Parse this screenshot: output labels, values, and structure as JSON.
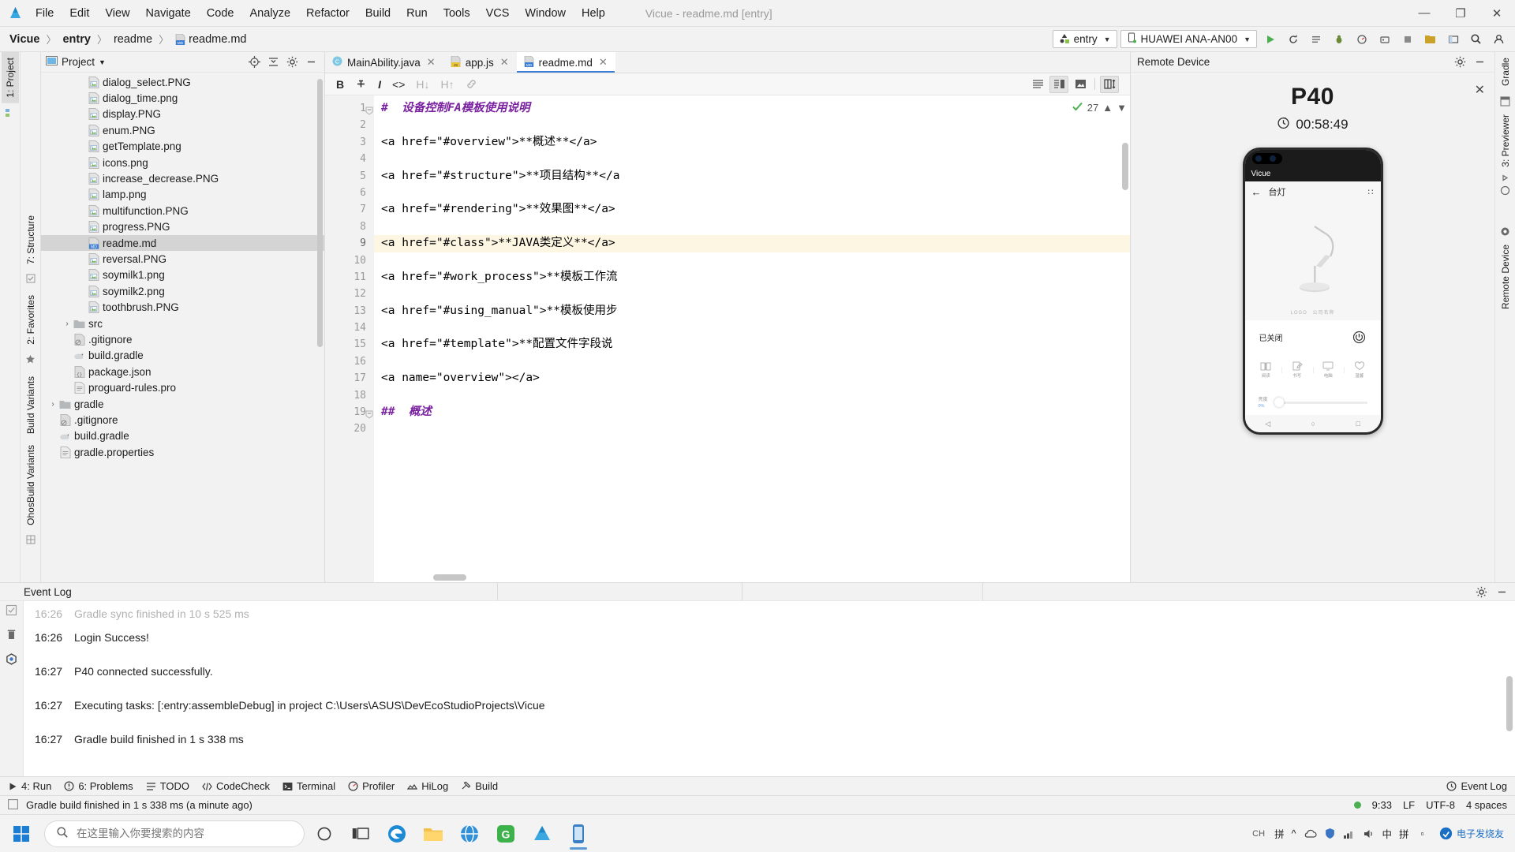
{
  "window": {
    "title": "Vicue - readme.md [entry]",
    "minimize": "—",
    "maximize": "❐",
    "close": "✕"
  },
  "menu": [
    "File",
    "Edit",
    "View",
    "Navigate",
    "Code",
    "Analyze",
    "Refactor",
    "Build",
    "Run",
    "Tools",
    "VCS",
    "Window",
    "Help"
  ],
  "breadcrumb": {
    "items": [
      "Vicue",
      "entry",
      "readme",
      "readme.md"
    ],
    "separator": "〉"
  },
  "toolbar": {
    "module_selector": "entry",
    "device_selector": "HUAWEI ANA-AN00",
    "caret": "▼"
  },
  "project_pane": {
    "title": "Project",
    "caret": "▼",
    "tree": [
      {
        "label": "dialog_select.PNG",
        "icon": "image-file-icon",
        "indent": 3,
        "arrow": "",
        "selected": false
      },
      {
        "label": "dialog_time.png",
        "icon": "image-file-icon",
        "indent": 3,
        "arrow": "",
        "selected": false
      },
      {
        "label": "display.PNG",
        "icon": "image-file-icon",
        "indent": 3,
        "arrow": "",
        "selected": false
      },
      {
        "label": "enum.PNG",
        "icon": "image-file-icon",
        "indent": 3,
        "arrow": "",
        "selected": false
      },
      {
        "label": "getTemplate.png",
        "icon": "image-file-icon",
        "indent": 3,
        "arrow": "",
        "selected": false
      },
      {
        "label": "icons.png",
        "icon": "image-file-icon",
        "indent": 3,
        "arrow": "",
        "selected": false
      },
      {
        "label": "increase_decrease.PNG",
        "icon": "image-file-icon",
        "indent": 3,
        "arrow": "",
        "selected": false
      },
      {
        "label": "lamp.png",
        "icon": "image-file-icon",
        "indent": 3,
        "arrow": "",
        "selected": false
      },
      {
        "label": "multifunction.PNG",
        "icon": "image-file-icon",
        "indent": 3,
        "arrow": "",
        "selected": false
      },
      {
        "label": "progress.PNG",
        "icon": "image-file-icon",
        "indent": 3,
        "arrow": "",
        "selected": false
      },
      {
        "label": "readme.md",
        "icon": "markdown-file-icon",
        "indent": 3,
        "arrow": "",
        "selected": true
      },
      {
        "label": "reversal.PNG",
        "icon": "image-file-icon",
        "indent": 3,
        "arrow": "",
        "selected": false
      },
      {
        "label": "soymilk1.png",
        "icon": "image-file-icon",
        "indent": 3,
        "arrow": "",
        "selected": false
      },
      {
        "label": "soymilk2.png",
        "icon": "image-file-icon",
        "indent": 3,
        "arrow": "",
        "selected": false
      },
      {
        "label": "toothbrush.PNG",
        "icon": "image-file-icon",
        "indent": 3,
        "arrow": "",
        "selected": false
      },
      {
        "label": "src",
        "icon": "folder-icon",
        "indent": 2,
        "arrow": "›",
        "selected": false
      },
      {
        "label": ".gitignore",
        "icon": "gitignore-file-icon",
        "indent": 2,
        "arrow": "",
        "selected": false
      },
      {
        "label": "build.gradle",
        "icon": "gradle-file-icon",
        "indent": 2,
        "arrow": "",
        "selected": false
      },
      {
        "label": "package.json",
        "icon": "json-file-icon",
        "indent": 2,
        "arrow": "",
        "selected": false
      },
      {
        "label": "proguard-rules.pro",
        "icon": "text-file-icon",
        "indent": 2,
        "arrow": "",
        "selected": false
      },
      {
        "label": "gradle",
        "icon": "folder-icon",
        "indent": 1,
        "arrow": "›",
        "selected": false
      },
      {
        "label": ".gitignore",
        "icon": "gitignore-file-icon",
        "indent": 1,
        "arrow": "",
        "selected": false
      },
      {
        "label": "build.gradle",
        "icon": "gradle-file-icon",
        "indent": 1,
        "arrow": "",
        "selected": false
      },
      {
        "label": "gradle.properties",
        "icon": "properties-file-icon",
        "indent": 1,
        "arrow": "",
        "selected": false
      }
    ]
  },
  "left_strips": {
    "outer": [
      "1: Project"
    ],
    "inner": [
      "7: Structure",
      "2: Favorites",
      "Build Variants",
      "OhosBuild Variants"
    ]
  },
  "right_strips": [
    "Gradle",
    "3: Previewer",
    "Remote Device"
  ],
  "editor": {
    "tabs": [
      {
        "label": "MainAbility.java",
        "icon": "java-file-icon",
        "active": false,
        "close": "✕"
      },
      {
        "label": "app.js",
        "icon": "js-file-icon",
        "active": false,
        "close": "✕"
      },
      {
        "label": "readme.md",
        "icon": "markdown-file-icon",
        "active": true,
        "close": "✕"
      }
    ],
    "md_toolbar": [
      "B",
      "S",
      "I",
      "<>",
      "H↓",
      "H↑",
      "link"
    ],
    "inspection_count": "27",
    "lines": [
      {
        "n": "1",
        "text": "#  设备控制FA模板使用说明",
        "style": "h1",
        "fold": true,
        "hl": false
      },
      {
        "n": "2",
        "text": "",
        "style": "",
        "fold": false,
        "hl": false
      },
      {
        "n": "3",
        "text": "<a href=\"#overview\">**概述**</a>",
        "style": "code",
        "fold": false,
        "hl": false
      },
      {
        "n": "4",
        "text": "",
        "style": "",
        "fold": false,
        "hl": false
      },
      {
        "n": "5",
        "text": "<a href=\"#structure\">**项目结构**</a",
        "style": "code",
        "fold": false,
        "hl": false
      },
      {
        "n": "6",
        "text": "",
        "style": "",
        "fold": false,
        "hl": false
      },
      {
        "n": "7",
        "text": "<a href=\"#rendering\">**效果图**</a>",
        "style": "code",
        "fold": false,
        "hl": false
      },
      {
        "n": "8",
        "text": "",
        "style": "",
        "fold": false,
        "hl": false
      },
      {
        "n": "9",
        "text": "<a href=\"#class\">**JAVA类定义**</a>",
        "style": "code",
        "fold": false,
        "hl": true
      },
      {
        "n": "10",
        "text": "",
        "style": "",
        "fold": false,
        "hl": false
      },
      {
        "n": "11",
        "text": "<a href=\"#work_process\">**模板工作流",
        "style": "code",
        "fold": false,
        "hl": false
      },
      {
        "n": "12",
        "text": "",
        "style": "",
        "fold": false,
        "hl": false
      },
      {
        "n": "13",
        "text": "<a href=\"#using_manual\">**模板使用步",
        "style": "code",
        "fold": false,
        "hl": false
      },
      {
        "n": "14",
        "text": "",
        "style": "",
        "fold": false,
        "hl": false
      },
      {
        "n": "15",
        "text": "<a href=\"#template\">**配置文件字段说",
        "style": "code",
        "fold": false,
        "hl": false
      },
      {
        "n": "16",
        "text": "",
        "style": "",
        "fold": false,
        "hl": false
      },
      {
        "n": "17",
        "text": "<a name=\"overview\"></a>",
        "style": "code",
        "fold": false,
        "hl": false
      },
      {
        "n": "18",
        "text": "",
        "style": "",
        "fold": false,
        "hl": false
      },
      {
        "n": "19",
        "text": "##  概述",
        "style": "h2",
        "fold": true,
        "hl": false
      },
      {
        "n": "20",
        "text": "",
        "style": "",
        "fold": false,
        "hl": false
      }
    ]
  },
  "remote_device": {
    "title": "Remote Device",
    "device_name": "P40",
    "timer": "00:58:49",
    "close": "✕",
    "phone": {
      "app_title": "Vicue",
      "nav_back": "←",
      "nav_title": "台灯",
      "nav_menu": "⁙",
      "logo_text": "LOGO",
      "logo_sub": "公司名称",
      "power_label": "已关闭",
      "power_icon": "power-icon",
      "modes": [
        {
          "label": "阅读",
          "icon": "book-icon"
        },
        {
          "label": "书写",
          "icon": "write-icon"
        },
        {
          "label": "电脑",
          "icon": "monitor-icon"
        },
        {
          "label": "温馨",
          "icon": "heart-icon"
        }
      ],
      "brightness_label": "亮度",
      "brightness_value": "0%",
      "sysnav": [
        "◁",
        "○",
        "□"
      ]
    }
  },
  "event_log": {
    "title": "Event Log",
    "lines": [
      {
        "time": "16:26",
        "text": "Gradle sync finished in 10 s 525 ms",
        "clipped": true
      },
      {
        "time": "16:26",
        "text": "Login Success!",
        "clipped": false
      },
      {
        "time": "16:27",
        "text": "P40 connected successfully.",
        "clipped": false
      },
      {
        "time": "16:27",
        "text": "Executing tasks: [:entry:assembleDebug] in project C:\\Users\\ASUS\\DevEcoStudioProjects\\Vicue",
        "clipped": false
      },
      {
        "time": "16:27",
        "text": "Gradle build finished in 1 s 338 ms",
        "clipped": false
      }
    ]
  },
  "tool_tabs": [
    {
      "label": "4: Run",
      "icon": "run-icon"
    },
    {
      "label": "6: Problems",
      "icon": "problems-icon"
    },
    {
      "label": "TODO",
      "icon": "todo-icon"
    },
    {
      "label": "CodeCheck",
      "icon": "codecheck-icon"
    },
    {
      "label": "Terminal",
      "icon": "terminal-icon"
    },
    {
      "label": "Profiler",
      "icon": "profiler-icon"
    },
    {
      "label": "HiLog",
      "icon": "hilog-icon"
    },
    {
      "label": "Build",
      "icon": "build-icon"
    }
  ],
  "tool_tabs_right": {
    "label": "Event Log",
    "icon": "event-log-icon"
  },
  "status_bar": {
    "message": "Gradle build finished in 1 s 338 ms (a minute ago)",
    "time": "9:33",
    "line_sep": "LF",
    "encoding": "UTF-8",
    "indent": "4 spaces"
  },
  "taskbar": {
    "search_placeholder": "在这里输入你要搜索的内容",
    "apps": [
      {
        "name": "cortana-icon"
      },
      {
        "name": "task-view-icon"
      },
      {
        "name": "edge-icon"
      },
      {
        "name": "file-explorer-icon"
      },
      {
        "name": "browser-icon"
      },
      {
        "name": "app-g-icon"
      },
      {
        "name": "app-blue-icon"
      },
      {
        "name": "deveco-studio-icon"
      }
    ],
    "tray": {
      "ime_label": "拼",
      "lang": "中",
      "pinyin": "拼",
      "watermark": "电子发烧友"
    }
  },
  "colors": {
    "accent": "#3c7fd4",
    "heading": "#7a22a0",
    "selection": "#d4d4d4",
    "highlight_line": "#fdf6e3",
    "green": "#4caf50"
  }
}
